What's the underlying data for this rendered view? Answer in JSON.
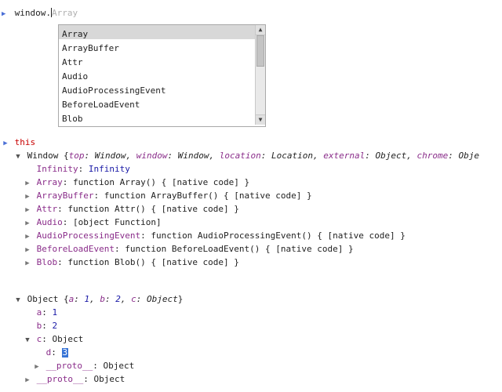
{
  "console_input": {
    "typed": "window.",
    "ghost": "Array"
  },
  "autocomplete": {
    "items": [
      "Array",
      "ArrayBuffer",
      "Attr",
      "Audio",
      "AudioProcessingEvent",
      "BeforeLoadEvent",
      "Blob"
    ],
    "selected_index": 0
  },
  "this_label": "this",
  "window_preview": {
    "type": "Window",
    "pairs": [
      {
        "k": "top",
        "v": "Window"
      },
      {
        "k": "window",
        "v": "Window"
      },
      {
        "k": "location",
        "v": "Location"
      },
      {
        "k": "external",
        "v": "Object"
      },
      {
        "k": "chrome",
        "v": "Obje"
      }
    ]
  },
  "window_children": [
    {
      "k": "Infinity",
      "v": "Infinity",
      "is_val": true,
      "arrow": false,
      "val_class": "val-num"
    },
    {
      "k": "Array",
      "v": "function Array() { [native code] }",
      "arrow": true
    },
    {
      "k": "ArrayBuffer",
      "v": "function ArrayBuffer() { [native code] }",
      "arrow": true
    },
    {
      "k": "Attr",
      "v": "function Attr() { [native code] }",
      "arrow": true
    },
    {
      "k": "Audio",
      "v": "[object Function]",
      "arrow": true
    },
    {
      "k": "AudioProcessingEvent",
      "v": "function AudioProcessingEvent() { [native code] }",
      "arrow": true
    },
    {
      "k": "BeforeLoadEvent",
      "v": "function BeforeLoadEvent() { [native code] }",
      "arrow": true
    },
    {
      "k": "Blob",
      "v": "function Blob() { [native code] }",
      "arrow": true
    }
  ],
  "object_preview": {
    "type": "Object",
    "pairs": [
      {
        "k": "a",
        "v": "1"
      },
      {
        "k": "b",
        "v": "2"
      },
      {
        "k": "c",
        "v": "Object"
      }
    ]
  },
  "object_children": {
    "a": "1",
    "b": "2",
    "c_label": "c",
    "c_type": "Object",
    "d_label": "d",
    "d_value": "3",
    "proto_label": "__proto__",
    "proto_type": "Object"
  }
}
